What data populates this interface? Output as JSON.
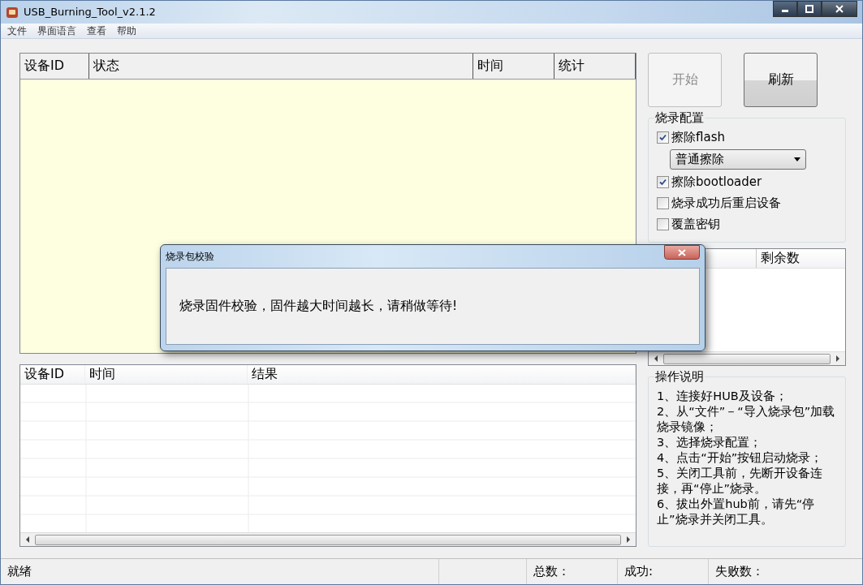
{
  "window": {
    "title": "USB_Burning_Tool_v2.1.2"
  },
  "menu": [
    "文件",
    "界面语言",
    "查看",
    "帮助"
  ],
  "device_table": {
    "columns": [
      "设备ID",
      "状态",
      "时间",
      "统计"
    ]
  },
  "buttons": [
    {
      "label": "开始",
      "disabled": true
    },
    {
      "label": "刷新",
      "disabled": false
    }
  ],
  "burn_config": {
    "title": "烧录配置",
    "options": [
      {
        "kind": "checkbox",
        "label": "擦除flash",
        "checked": true
      },
      {
        "kind": "dropdown",
        "value": "普通擦除"
      },
      {
        "kind": "checkbox",
        "label": "擦除bootloader",
        "checked": true
      },
      {
        "kind": "checkbox",
        "label": "烧录成功后重启设备",
        "checked": false
      },
      {
        "kind": "checkbox",
        "label": "覆盖密钥",
        "checked": false
      }
    ]
  },
  "remaining_table": {
    "column_2": "剩余数"
  },
  "instructions": {
    "title": "操作说明",
    "lines": [
      "1、连接好HUB及设备；",
      "2、从“文件”－“导入烧录包”加载烧录镜像；",
      "3、选择烧录配置；",
      "4、点击“开始”按钮启动烧录；",
      "5、关闭工具前，先断开设备连接，再“停止”烧录。",
      "6、拔出外置hub前，请先“停止”烧录并关闭工具。"
    ]
  },
  "result_table": {
    "columns": [
      "设备ID",
      "时间",
      "结果"
    ]
  },
  "status_bar": {
    "status": "就绪",
    "total": "总数：",
    "success": "成功:",
    "failed": "失败数："
  },
  "dialog": {
    "title": "烧录包校验",
    "message": "烧录固件校验，固件越大时间越长，请稍做等待!"
  }
}
